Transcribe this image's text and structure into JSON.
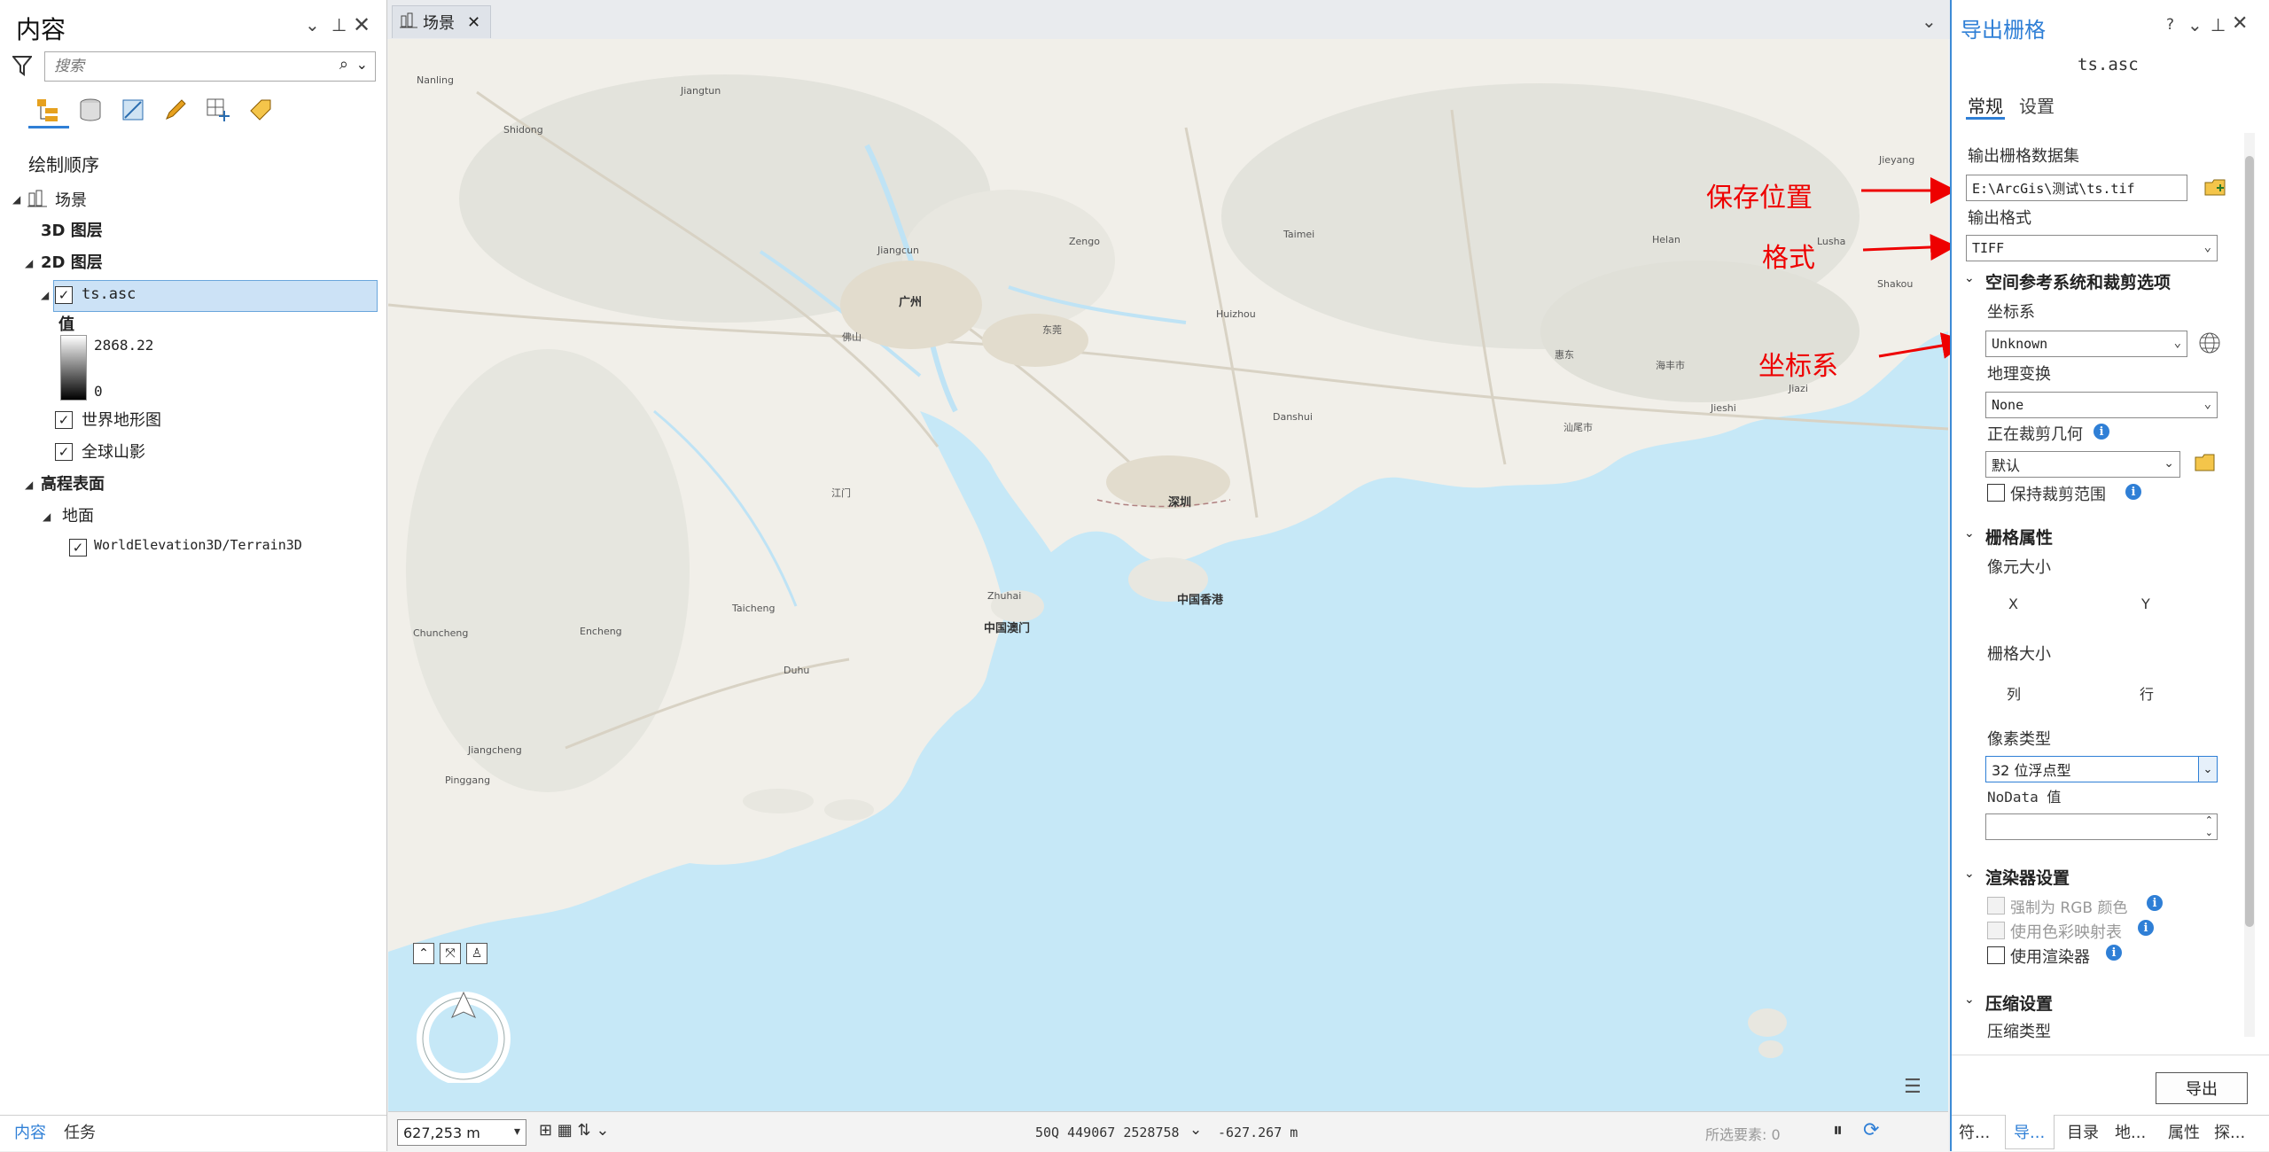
{
  "contents": {
    "title": "内容",
    "search_placeholder": "搜索",
    "draw_order": "绘制顺序",
    "tree": {
      "scene": "场景",
      "layers3d": "3D 图层",
      "layers2d": "2D 图层",
      "raster": "ts.asc",
      "value_label": "值",
      "value_max": "2868.22",
      "value_min": "0",
      "topo": "世界地形图",
      "hillshade": "全球山影",
      "elevation": "高程表面",
      "ground": "地面",
      "terrain": "WorldElevation3D/Terrain3D"
    },
    "bottom_tabs": [
      "内容",
      "任务"
    ]
  },
  "map": {
    "tab_label": "场景",
    "places": [
      {
        "t": "Nanling"
      },
      {
        "t": "Jiangtun"
      },
      {
        "t": "Shidong"
      },
      {
        "t": "Zengo"
      },
      {
        "t": "Taimei"
      },
      {
        "t": "Helan"
      },
      {
        "t": "Lusha"
      },
      {
        "t": "Jieyang"
      },
      {
        "t": "Jiangcun"
      },
      {
        "t": "广州"
      },
      {
        "t": "佛山"
      },
      {
        "t": "东莞"
      },
      {
        "t": "Huizhou"
      },
      {
        "t": "Danshui"
      },
      {
        "t": "惠东"
      },
      {
        "t": "Jiazi"
      },
      {
        "t": "Jieshi"
      },
      {
        "t": "汕尾市"
      },
      {
        "t": "海丰市"
      },
      {
        "t": "江门"
      },
      {
        "t": "深圳"
      },
      {
        "t": "中国香港"
      },
      {
        "t": "Zhuhai"
      },
      {
        "t": "中国澳门"
      },
      {
        "t": "Taicheng"
      },
      {
        "t": "Encheng"
      },
      {
        "t": "Chuncheng"
      },
      {
        "t": "Duhu"
      },
      {
        "t": "Jiangcheng"
      },
      {
        "t": "Pinggang"
      },
      {
        "t": "Shakou"
      }
    ],
    "compass_label": "N"
  },
  "statusbar": {
    "scale": "627,253 m",
    "coords": "50Q 449067 2528758",
    "elevation": "-627.267 m",
    "selected": "所选要素: 0"
  },
  "export": {
    "title": "导出栅格",
    "file_name": "ts.asc",
    "tabs": [
      "常规",
      "设置"
    ],
    "output_dataset_label": "输出栅格数据集",
    "output_dataset_value": "E:\\ArcGis\\测试\\ts.tif",
    "output_format_label": "输出格式",
    "output_format_value": "TIFF",
    "sr_section": "空间参考系统和裁剪选项",
    "coord_label": "坐标系",
    "coord_value": "Unknown",
    "geo_transform_label": "地理变换",
    "geo_transform_value": "None",
    "clip_label": "正在裁剪几何",
    "clip_value": "默认",
    "keep_clip_label": "保持裁剪范围",
    "raster_props_section": "栅格属性",
    "cell_size_label": "像元大小",
    "x_label": "X",
    "y_label": "Y",
    "raster_size_label": "栅格大小",
    "col_label": "列",
    "row_label": "行",
    "pixel_type_label": "像素类型",
    "pixel_type_value": "32 位浮点型",
    "nodata_label": "NoData 值",
    "renderer_section": "渲染器设置",
    "force_rgb": "强制为 RGB 颜色",
    "use_colormap": "使用色彩映射表",
    "use_renderer": "使用渲染器",
    "compress_section": "压缩设置",
    "compress_type_label": "压缩类型",
    "export_button": "导出",
    "bottom_tabs": [
      "符...",
      "导...",
      "目录",
      "地...",
      "属性",
      "探..."
    ]
  },
  "annotations": {
    "save_location": "保存位置",
    "format": "格式",
    "coord_system": "坐标系"
  },
  "colors": {
    "accent": "#3c8bd6",
    "water": "#c6e8f7",
    "land": "#f1efe9",
    "annotation": "#e00000"
  }
}
